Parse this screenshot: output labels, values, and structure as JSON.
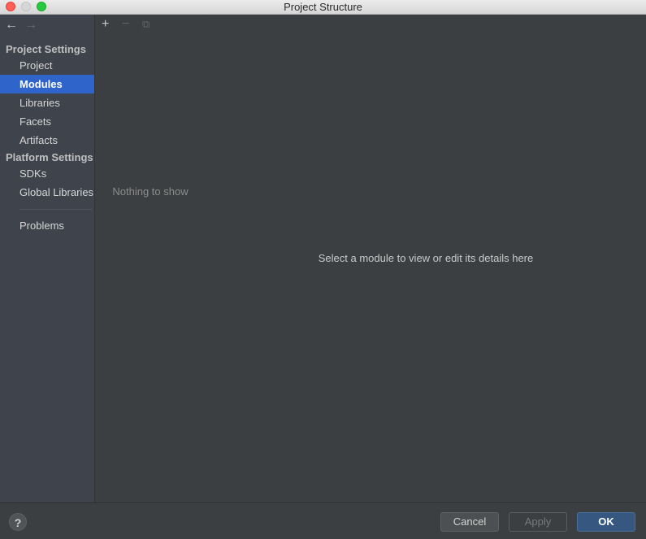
{
  "window": {
    "title": "Project Structure"
  },
  "sidebar": {
    "nav_back": "←",
    "nav_forward": "→",
    "project_settings": {
      "heading": "Project Settings",
      "items": [
        {
          "label": "Project"
        },
        {
          "label": "Modules",
          "selected": true
        },
        {
          "label": "Libraries"
        },
        {
          "label": "Facets"
        },
        {
          "label": "Artifacts"
        }
      ]
    },
    "platform_settings": {
      "heading": "Platform Settings",
      "items": [
        {
          "label": "SDKs"
        },
        {
          "label": "Global Libraries"
        }
      ]
    },
    "problems": {
      "label": "Problems"
    }
  },
  "modules_list": {
    "toolbar": {
      "add": "+",
      "remove": "−",
      "copy": "⧉"
    },
    "empty_text": "Nothing to show"
  },
  "details": {
    "placeholder": "Select a module to view or edit its details here"
  },
  "footer": {
    "help": "?",
    "cancel": "Cancel",
    "apply": "Apply",
    "ok": "OK"
  },
  "colors": {
    "accent_selected": "#2f65ca",
    "ok_button": "#365880",
    "background": "#3c3f41"
  }
}
